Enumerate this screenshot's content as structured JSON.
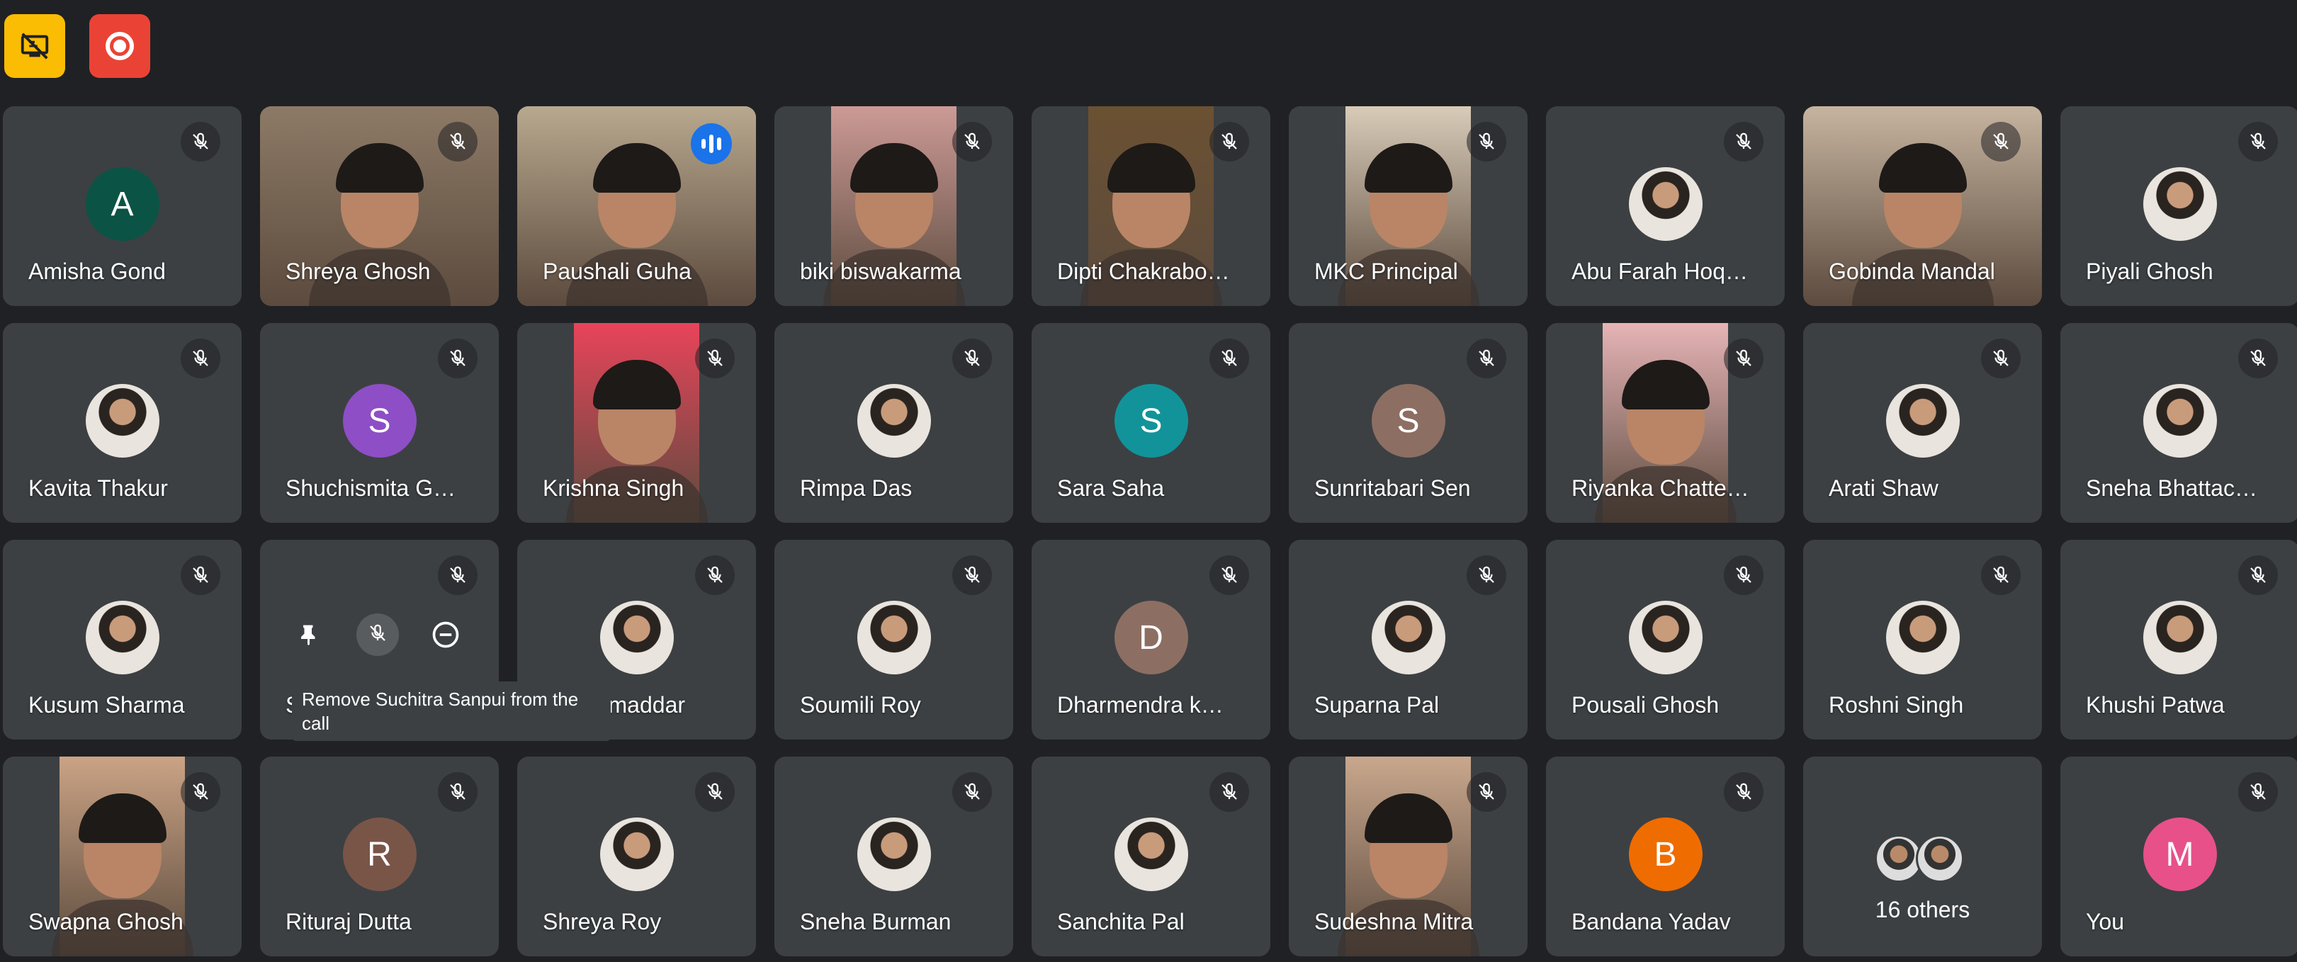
{
  "toolbar": {
    "present_icon": "screen-share-off-icon",
    "record_icon": "record-icon"
  },
  "colors": {
    "background": "#202124",
    "tile": "#3c4043",
    "active_border": "#8ab4f8",
    "speaking": "#1a73e8"
  },
  "participants": [
    {
      "name": "Amisha Gond",
      "type": "letter",
      "letter": "A",
      "color": "#0b5345"
    },
    {
      "name": "Shreya Ghosh",
      "type": "video",
      "bg": "#8d7a66"
    },
    {
      "name": "Paushali Guha",
      "type": "video",
      "bg": "#b8a88e",
      "active": true
    },
    {
      "name": "biki biswakarma",
      "type": "video",
      "bg": "#cc9a96"
    },
    {
      "name": "Dipti Chakrabo…",
      "type": "video",
      "bg": "#6b5132"
    },
    {
      "name": "MKC Principal",
      "type": "video",
      "bg": "#d8cbb8"
    },
    {
      "name": "Abu Farah Hoq…",
      "type": "photo"
    },
    {
      "name": "Gobinda Mandal",
      "type": "video",
      "bg": "#c6b4a0"
    },
    {
      "name": "Piyali Ghosh",
      "type": "photo"
    },
    {
      "name": "Kavita Thakur",
      "type": "photo"
    },
    {
      "name": "Shuchismita G…",
      "type": "letter",
      "letter": "S",
      "color": "#8e4ec6"
    },
    {
      "name": "Krishna Singh",
      "type": "video",
      "bg": "#e8445a"
    },
    {
      "name": "Rimpa Das",
      "type": "photo"
    },
    {
      "name": "Sara Saha",
      "type": "letter",
      "letter": "S",
      "color": "#12939a"
    },
    {
      "name": "Sunritabari Sen",
      "type": "letter",
      "letter": "S",
      "color": "#8d6e63"
    },
    {
      "name": "Riyanka Chatte…",
      "type": "video",
      "bg": "#e6b4b6"
    },
    {
      "name": "Arati Shaw",
      "type": "photo"
    },
    {
      "name": "Sneha Bhattac…",
      "type": "photo"
    },
    {
      "name": "Kusum Sharma",
      "type": "photo"
    },
    {
      "name": "S",
      "type": "hover"
    },
    {
      "name": "eta Samaddar",
      "type": "photo"
    },
    {
      "name": "Soumili Roy",
      "type": "photo"
    },
    {
      "name": "Dharmendra k…",
      "type": "letter",
      "letter": "D",
      "color": "#8d6e63"
    },
    {
      "name": "Suparna Pal",
      "type": "photo"
    },
    {
      "name": "Pousali Ghosh",
      "type": "photo"
    },
    {
      "name": "Roshni Singh",
      "type": "photo"
    },
    {
      "name": "Khushi Patwa",
      "type": "photo"
    },
    {
      "name": "Swapna Ghosh",
      "type": "video",
      "bg": "#caa385"
    },
    {
      "name": "Rituraj Dutta",
      "type": "letter",
      "letter": "R",
      "color": "#795548"
    },
    {
      "name": "Shreya Roy",
      "type": "photo"
    },
    {
      "name": "Sneha Burman",
      "type": "photo"
    },
    {
      "name": "Sanchita Pal",
      "type": "photo"
    },
    {
      "name": "Sudeshna Mitra",
      "type": "video",
      "bg": "#c9a78d"
    },
    {
      "name": "Bandana Yadav",
      "type": "letter",
      "letter": "B",
      "color": "#ef6c00"
    },
    {
      "name": "16 others",
      "type": "others"
    },
    {
      "name": "You",
      "type": "letter",
      "letter": "M",
      "color": "#e8508a",
      "nomic": false
    }
  ],
  "tooltip": {
    "text": "Remove Suchitra Sanpui from the call"
  }
}
